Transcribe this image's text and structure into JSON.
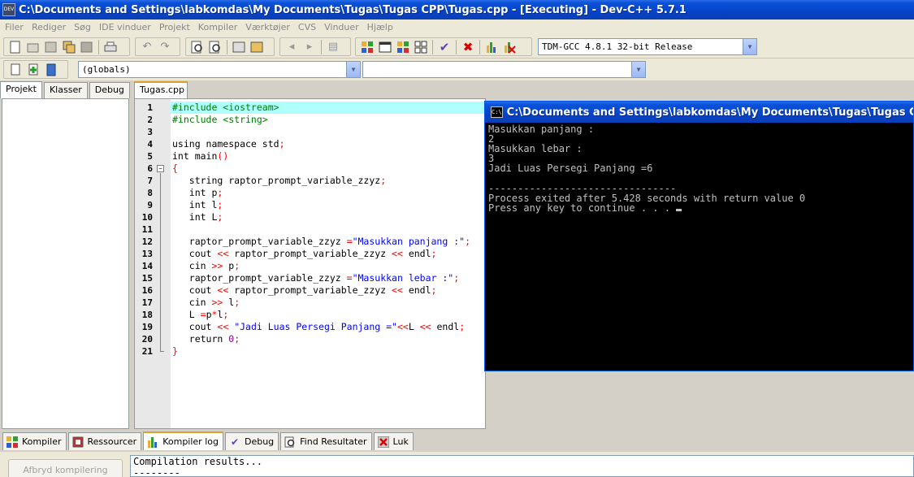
{
  "window": {
    "title": "C:\\Documents and Settings\\labkomdas\\My Documents\\Tugas\\Tugas CPP\\Tugas.cpp - [Executing] - Dev-C++ 5.7.1",
    "icon_label": "DEV"
  },
  "menu": [
    "Filer",
    "Rediger",
    "Søg",
    "IDE vinduer",
    "Projekt",
    "Kompiler",
    "Værktøjer",
    "CVS",
    "Vinduer",
    "Hjælp"
  ],
  "toolbar": {
    "compiler_select": "TDM-GCC 4.8.1 32-bit Release",
    "scope_select": "(globals)",
    "function_select": ""
  },
  "left_tabs": [
    "Projekt",
    "Klasser",
    "Debug"
  ],
  "editor": {
    "tab_label": "Tugas.cpp",
    "lines": [
      {
        "n": "1",
        "text": "#include <iostream>",
        "kind": "pre"
      },
      {
        "n": "2",
        "text": "#include <string>",
        "kind": "pre"
      },
      {
        "n": "3",
        "text": "",
        "kind": "txt"
      },
      {
        "n": "4",
        "text": "using namespace std;",
        "kind": "txt"
      },
      {
        "n": "5",
        "text": "int main()",
        "kind": "txt"
      },
      {
        "n": "6",
        "text": "{",
        "kind": "brace"
      },
      {
        "n": "7",
        "text": "   string raptor_prompt_variable_zzyz;",
        "kind": "txt"
      },
      {
        "n": "8",
        "text": "   int p;",
        "kind": "txt"
      },
      {
        "n": "9",
        "text": "   int l;",
        "kind": "txt"
      },
      {
        "n": "10",
        "text": "   int L;",
        "kind": "txt"
      },
      {
        "n": "11",
        "text": "",
        "kind": "txt"
      },
      {
        "n": "12",
        "text": "   raptor_prompt_variable_zzyz =\"Masukkan panjang :\";",
        "kind": "txt"
      },
      {
        "n": "13",
        "text": "   cout << raptor_prompt_variable_zzyz << endl;",
        "kind": "txt"
      },
      {
        "n": "14",
        "text": "   cin >> p;",
        "kind": "txt"
      },
      {
        "n": "15",
        "text": "   raptor_prompt_variable_zzyz =\"Masukkan lebar :\";",
        "kind": "txt"
      },
      {
        "n": "16",
        "text": "   cout << raptor_prompt_variable_zzyz << endl;",
        "kind": "txt"
      },
      {
        "n": "17",
        "text": "   cin >> l;",
        "kind": "txt"
      },
      {
        "n": "18",
        "text": "   L =p*l;",
        "kind": "txt"
      },
      {
        "n": "19",
        "text": "   cout << \"Jadi Luas Persegi Panjang =\"<<L << endl;",
        "kind": "txt"
      },
      {
        "n": "20",
        "text": "   return 0;",
        "kind": "txt"
      },
      {
        "n": "21",
        "text": "}",
        "kind": "brace"
      }
    ]
  },
  "console": {
    "title": "C:\\Documents and Settings\\labkomdas\\My Documents\\Tugas\\Tugas CPP\\Tugas.exe",
    "icon_label": "C:\\",
    "lines": [
      "Masukkan panjang :",
      "2",
      "Masukkan lebar :",
      "3",
      "Jadi Luas Persegi Panjang =6",
      "",
      "--------------------------------",
      "Process exited after 5.428 seconds with return value 0",
      "Press any key to continue . . . "
    ]
  },
  "bottom_tabs": [
    {
      "label": "Kompiler",
      "icon": "grid-icon"
    },
    {
      "label": "Ressourcer",
      "icon": "resources-icon"
    },
    {
      "label": "Kompiler log",
      "icon": "chart-icon"
    },
    {
      "label": "Debug",
      "icon": "check-icon"
    },
    {
      "label": "Find Resultater",
      "icon": "find-icon"
    },
    {
      "label": "Luk",
      "icon": "close-icon"
    }
  ],
  "bottom": {
    "abort_button": "Afbryd kompilering",
    "log_lines": [
      "Compilation results...",
      "--------"
    ]
  },
  "colors": {
    "title_blue": "#0a52d8",
    "preprocessor": "#008000",
    "string": "#0000ff",
    "operator": "#ff0000",
    "number": "#800080",
    "current_line": "#b0ffff"
  }
}
